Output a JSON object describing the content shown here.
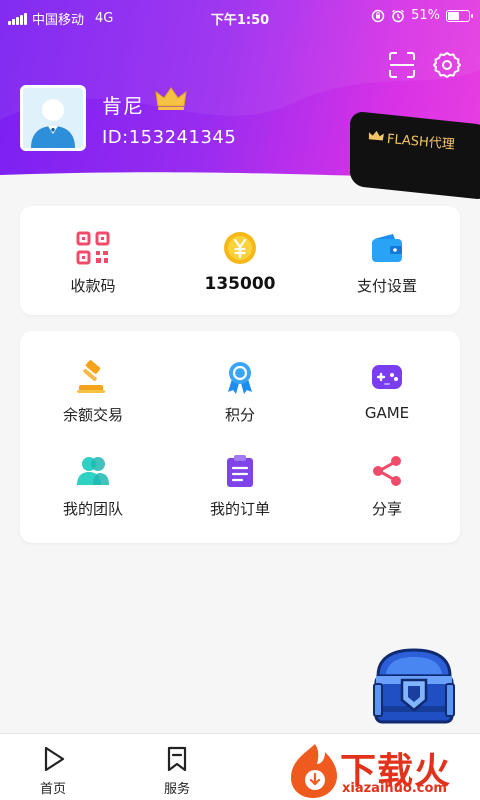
{
  "status_bar": {
    "carrier": "中国移动",
    "network": "4G",
    "time": "下午1:50",
    "battery": "51%",
    "battery_level": 0.51
  },
  "header": {
    "icons": [
      "scan-icon",
      "settings-icon"
    ],
    "user": {
      "name": "肯尼",
      "id_text": "ID:153241345",
      "badge_label": "FLASH代理"
    }
  },
  "wallet_card": {
    "items": [
      {
        "label": "收款码",
        "icon": "qr-code-icon"
      },
      {
        "label": "",
        "amount": "135000",
        "icon": "coin-icon"
      },
      {
        "label": "支付设置",
        "icon": "wallet-icon"
      }
    ]
  },
  "menu_card": {
    "items": [
      {
        "label": "余额交易",
        "icon": "gavel-icon"
      },
      {
        "label": "积分",
        "icon": "medal-icon"
      },
      {
        "label": "GAME",
        "icon": "gamepad-icon"
      },
      {
        "label": "我的团队",
        "icon": "team-icon"
      },
      {
        "label": "我的订单",
        "icon": "clipboard-icon"
      },
      {
        "label": "分享",
        "icon": "share-icon"
      }
    ]
  },
  "floating": {
    "icon": "treasure-chest-icon"
  },
  "tabbar": {
    "items": [
      {
        "label": "首页",
        "icon": "play-icon"
      },
      {
        "label": "服务",
        "icon": "bookmark-icon"
      }
    ]
  },
  "watermark": {
    "text": "下载火",
    "url": "xiazaihuo.com"
  },
  "colors": {
    "gradient_start": "#7a1ff2",
    "gradient_end": "#e83fe0",
    "badge_bg": "#111111",
    "badge_text": "#f3c46a",
    "accent_red": "#e2321c"
  }
}
